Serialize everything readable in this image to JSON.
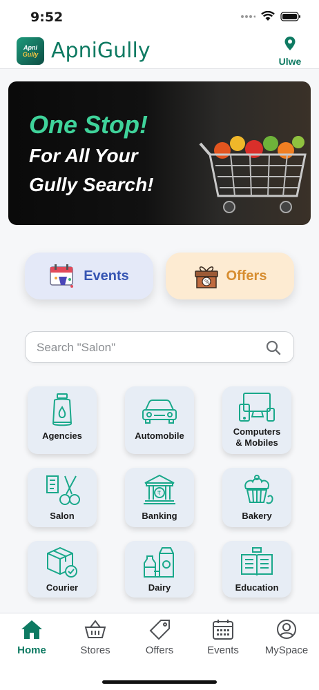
{
  "status": {
    "time": "9:52"
  },
  "header": {
    "logo_top": "Apni",
    "logo_bottom": "Gully",
    "title": "ApniGully",
    "location": "Ulwe"
  },
  "banner": {
    "line1": "One Stop!",
    "line2": "For All Your",
    "line3": "Gully Search!"
  },
  "quick": {
    "events_label": "Events",
    "offers_label": "Offers"
  },
  "search": {
    "placeholder": "Search \"Salon\""
  },
  "categories": [
    {
      "label": "Agencies",
      "icon": "gas-cylinder-icon"
    },
    {
      "label": "Automobile",
      "icon": "car-icon"
    },
    {
      "label": "Computers\n& Mobiles",
      "icon": "devices-icon"
    },
    {
      "label": "Salon",
      "icon": "scissors-icon"
    },
    {
      "label": "Banking",
      "icon": "bank-icon"
    },
    {
      "label": "Bakery",
      "icon": "cupcake-icon"
    },
    {
      "label": "Courier",
      "icon": "parcel-icon"
    },
    {
      "label": "Dairy",
      "icon": "milk-icon"
    },
    {
      "label": "Education",
      "icon": "book-icon"
    }
  ],
  "nav": [
    {
      "label": "Home",
      "active": true
    },
    {
      "label": "Stores",
      "active": false
    },
    {
      "label": "Offers",
      "active": false
    },
    {
      "label": "Events",
      "active": false
    },
    {
      "label": "MySpace",
      "active": false
    }
  ],
  "colors": {
    "brand": "#0e7a62",
    "events": "#3655b3",
    "offers": "#d78d30",
    "icon": "#19a88a"
  }
}
